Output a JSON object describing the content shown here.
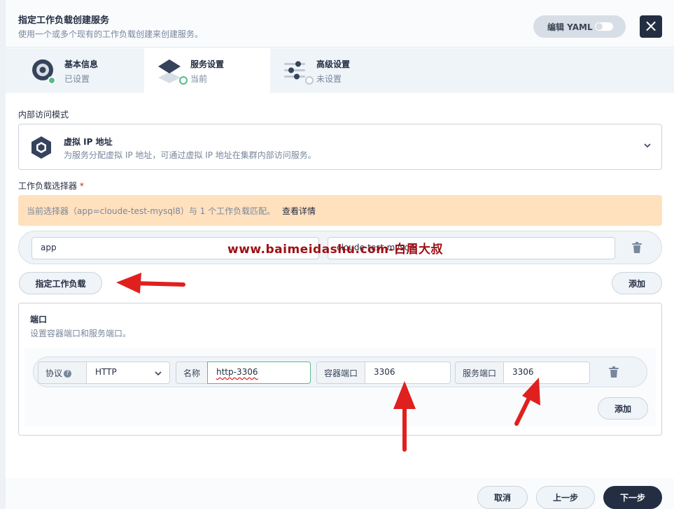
{
  "dialog": {
    "title": "指定工作负载创建服务",
    "subtitle": "使用一个或多个现有的工作负载创建来创建服务。",
    "yaml_label": "编辑 YAML",
    "close_icon": "×"
  },
  "steps": [
    {
      "title": "基本信息",
      "status": "已设置"
    },
    {
      "title": "服务设置",
      "status": "当前"
    },
    {
      "title": "高级设置",
      "status": "未设置"
    }
  ],
  "access_mode": {
    "label": "内部访问模式",
    "title": "虚拟 IP 地址",
    "description": "为服务分配虚拟 IP 地址，可通过虚拟 IP 地址在集群内部访问服务。"
  },
  "selector": {
    "label": "工作负载选择器",
    "required_mark": "*",
    "notice": "当前选择器（app=cloude-test-mysql8）与 1 个工作负载匹配。",
    "notice_link": "查看详情",
    "key": "app",
    "value": "cloude-test-mysql8",
    "specify_button": "指定工作负载",
    "add_button": "添加"
  },
  "ports": {
    "title": "端口",
    "description": "设置容器端口和服务端口。",
    "protocol_label": "协议",
    "help_icon": "?",
    "protocol": "HTTP",
    "name_label": "名称",
    "name": "http-3306",
    "container_port_label": "容器端口",
    "container_port": "3306",
    "service_port_label": "服务端口",
    "service_port": "3306",
    "add_button": "添加"
  },
  "footer": {
    "cancel": "取消",
    "prev": "上一步",
    "next": "下一步"
  },
  "watermark": "www.baimeidashu.com-白眉大叔",
  "colors": {
    "success": "#55bc8a",
    "dark": "#242e42",
    "notice_bg": "#ffe1be",
    "annotation": "#e0201f"
  }
}
